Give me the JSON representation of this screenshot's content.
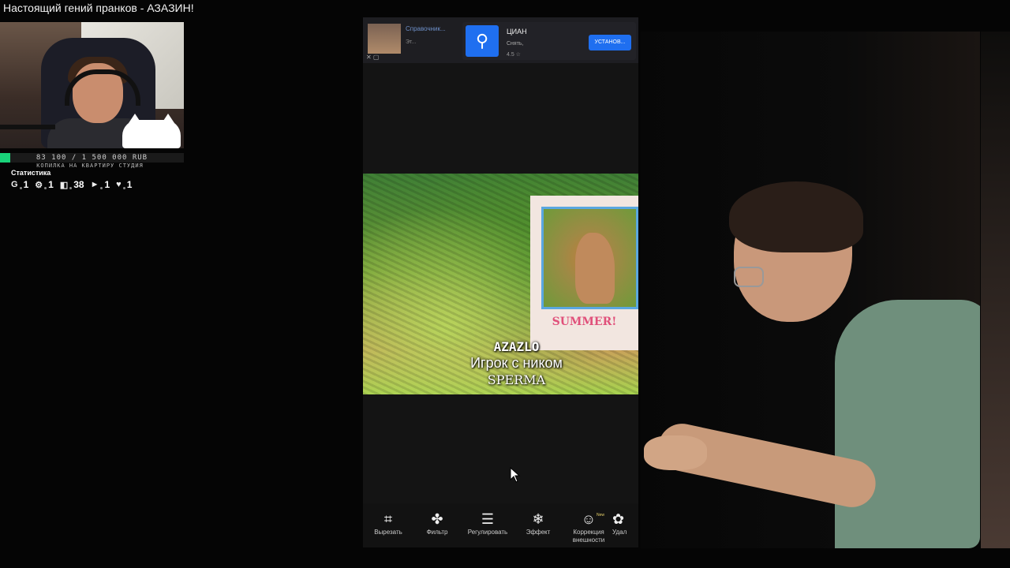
{
  "video": {
    "title": "Настоящий гений пранков - АЗАЗИН!"
  },
  "stream_overlay": {
    "goal_progress": "83 100 / 1 500 000 RUB",
    "goal_fraction": 0.055,
    "goal_label": "КОПИЛКА НА КВАРТИРУ СТУДИЯ",
    "stats_title": "Статистика",
    "stats": [
      {
        "icon": "g-icon",
        "glyph": "G",
        "value": "1"
      },
      {
        "icon": "gear-icon",
        "glyph": "⚙",
        "value": "1"
      },
      {
        "icon": "twitch-icon",
        "glyph": "◧",
        "value": "38"
      },
      {
        "icon": "trovo-icon",
        "glyph": "►",
        "value": "1"
      },
      {
        "icon": "heart-icon",
        "glyph": "♥",
        "value": "1"
      }
    ],
    "accent_color": "#19d37a"
  },
  "phone": {
    "ad": {
      "left_title": "Справочник...",
      "left_sub": "Эт...",
      "app_name": "ЦИАН",
      "app_sub": "Снять,",
      "rating": "4.5 ☆",
      "install_label": "УСТАНОВ...",
      "brand_color": "#1f6ff0"
    },
    "photo": {
      "postcard_text": "SUMMER!",
      "caption_line1": "AZAZLO",
      "caption_line2": "Игрок с ником",
      "caption_line3": "SPERMA"
    },
    "toolbar": [
      {
        "icon": "crop-icon",
        "glyph": "⌗",
        "label": "Вырезать"
      },
      {
        "icon": "filter-icon",
        "glyph": "✤",
        "label": "Фильтр"
      },
      {
        "icon": "adjust-icon",
        "glyph": "☰",
        "label": "Регулировать"
      },
      {
        "icon": "effect-icon",
        "glyph": "❄",
        "label": "Эффект"
      },
      {
        "icon": "face-correction-icon",
        "glyph": "☺",
        "label": "Коррекция внешности",
        "badge": "New"
      },
      {
        "icon": "remove-icon",
        "glyph": "✿",
        "label": "Удал"
      }
    ]
  }
}
